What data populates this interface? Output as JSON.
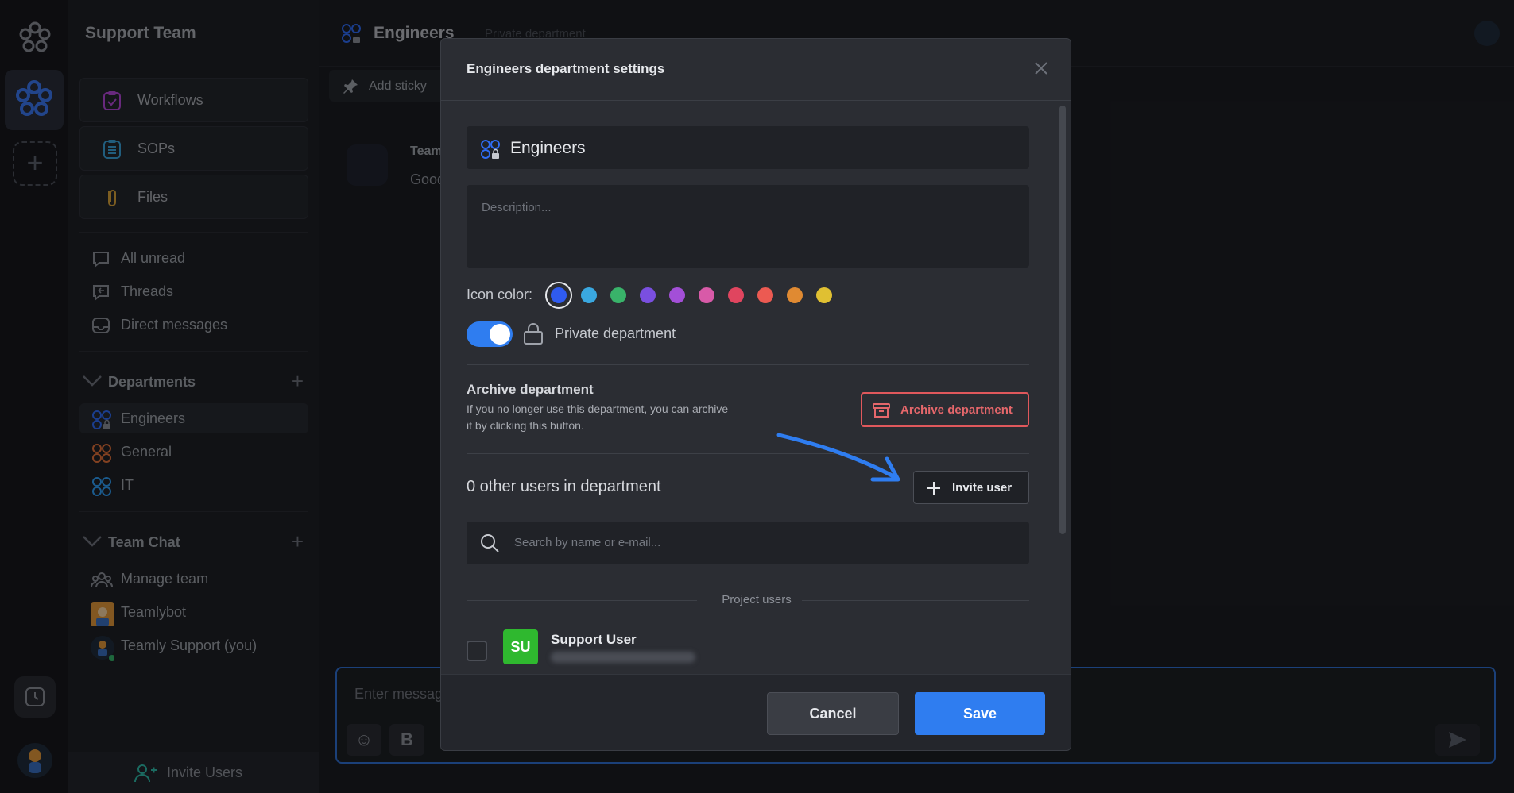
{
  "sidebar": {
    "team_name": "Support Team",
    "buttons": [
      {
        "label": "Workflows",
        "icon": "clipboard-check-icon"
      },
      {
        "label": "SOPs",
        "icon": "list-doc-icon"
      },
      {
        "label": "Files",
        "icon": "paperclip-icon"
      }
    ],
    "quick": [
      {
        "label": "All unread",
        "icon": "chat-bubble-icon"
      },
      {
        "label": "Threads",
        "icon": "threads-icon"
      },
      {
        "label": "Direct messages",
        "icon": "inbox-icon"
      }
    ],
    "departments_title": "Departments",
    "departments": [
      {
        "label": "Engineers",
        "color": "#2f6cf5",
        "locked": true
      },
      {
        "label": "General",
        "color": "#e2703a",
        "locked": false
      },
      {
        "label": "IT",
        "color": "#2f9ef5",
        "locked": false
      }
    ],
    "team_chat_title": "Team Chat",
    "team_chat": [
      {
        "label": "Manage team",
        "icon": "people-icon"
      },
      {
        "label": "Teamlybot",
        "icon": "bot-avatar-icon"
      },
      {
        "label": "Teamly Support (you)",
        "icon": "user-avatar-icon"
      }
    ],
    "invite_label": "Invite Users"
  },
  "header": {
    "title": "Engineers",
    "subtitle": "Private department",
    "sticky_label": "Add sticky"
  },
  "message": {
    "author": "Team",
    "text": "Good"
  },
  "composer": {
    "placeholder": "Enter messag",
    "bold_label": "B"
  },
  "modal": {
    "title": "Engineers department settings",
    "name_value": "Engineers",
    "description_placeholder": "Description...",
    "icon_color_label": "Icon color:",
    "colors": [
      "#2f5bf0",
      "#3aa8e0",
      "#39b36a",
      "#7a4fe0",
      "#a34fd8",
      "#d85aa8",
      "#e0455f",
      "#ec5a52",
      "#e08a32",
      "#e0c032"
    ],
    "selected_color": "#2f5bf0",
    "private_label": "Private department",
    "private_enabled": true,
    "archive_title": "Archive department",
    "archive_desc": "If you no longer use this department, you can archive it by clicking this button.",
    "archive_button": "Archive department",
    "users_count_text": "0 other users in department",
    "invite_button": "Invite user",
    "search_placeholder": "Search by name or e-mail...",
    "project_users_label": "Project users",
    "users": [
      {
        "initials": "SU",
        "name": "Support User",
        "avatar_color": "#2fb82f"
      }
    ],
    "cancel_label": "Cancel",
    "save_label": "Save"
  },
  "colors": {
    "accent": "#2f7df0",
    "danger": "#e0585c",
    "annotation_arrow": "#2f7df0"
  }
}
